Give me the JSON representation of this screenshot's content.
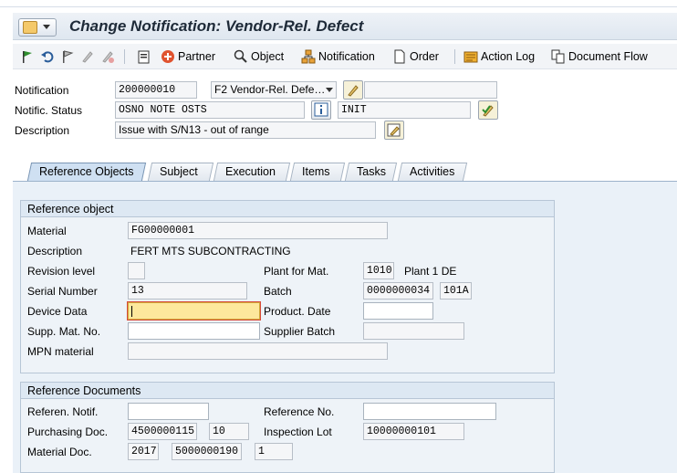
{
  "title": "Change Notification: Vendor-Rel. Defect",
  "toolbar": {
    "partner": "Partner",
    "object": "Object",
    "notification": "Notification",
    "order": "Order",
    "action_log": "Action Log",
    "document_flow": "Document Flow"
  },
  "header": {
    "notification_label": "Notification",
    "notification_value": "200000010",
    "notif_type": "F2 Vendor-Rel. Defe…",
    "status_label": "Notific. Status",
    "status_value": "OSNO NOTE OSTS",
    "status_code": "INIT",
    "description_label": "Description",
    "description_value": "Issue with S/N13 - out of range"
  },
  "tabs": [
    "Reference Objects",
    "Subject",
    "Execution",
    "Items",
    "Tasks",
    "Activities"
  ],
  "reference_object": {
    "title": "Reference object",
    "material_label": "Material",
    "material_value": "FG00000001",
    "description_label": "Description",
    "description_value": "FERT MTS SUBCONTRACTING",
    "revision_label": "Revision level",
    "plant_label": "Plant for Mat.",
    "plant_value": "1010",
    "plant_name": "Plant 1 DE",
    "serial_label": "Serial Number",
    "serial_value": "13",
    "batch_label": "Batch",
    "batch_value": "0000000034",
    "batch_value2": "101A",
    "device_label": "Device Data",
    "product_date_label": "Product. Date",
    "supp_mat_label": "Supp. Mat. No.",
    "supplier_batch_label": "Supplier Batch",
    "mpn_label": "MPN material"
  },
  "reference_documents": {
    "title": "Reference Documents",
    "ref_notif_label": "Referen. Notif.",
    "ref_no_label": "Reference No.",
    "purch_label": "Purchasing Doc.",
    "purch_value": "4500000115",
    "purch_item": "10",
    "insp_label": "Inspection Lot",
    "insp_value": "10000000101",
    "matdoc_label": "Material Doc.",
    "matdoc_year": "2017",
    "matdoc_value": "5000000190",
    "matdoc_item": "1"
  },
  "colors": {
    "title_bg": "#e3eaf2",
    "panel_bg": "#eaf1f8",
    "focus_field": "#fde89c",
    "tab_active": "#cfe0f2"
  }
}
